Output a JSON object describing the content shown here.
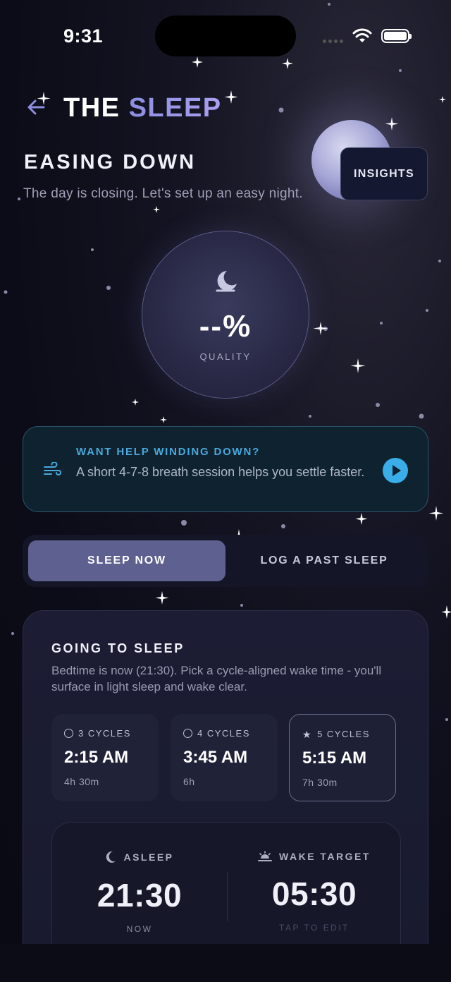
{
  "status_bar": {
    "time": "9:31"
  },
  "header": {
    "title_part1": "THE",
    "title_part2": "SLEEP",
    "insights_label": "INSIGHTS"
  },
  "intro": {
    "heading": "EASING DOWN",
    "subtitle": "The day is closing. Let's set up an easy night."
  },
  "quality": {
    "value": "--%",
    "label": "QUALITY"
  },
  "wind_down": {
    "title": "WANT HELP WINDING DOWN?",
    "description": "A short 4-7-8 breath session helps you settle faster."
  },
  "mode_toggle": {
    "active": "SLEEP NOW",
    "inactive": "LOG A PAST SLEEP"
  },
  "going_to_sleep": {
    "title": "GOING TO SLEEP",
    "description": "Bedtime is now (21:30). Pick a cycle-aligned wake time - you'll surface in light sleep and wake clear.",
    "cycles": [
      {
        "label": "3 CYCLES",
        "time": "2:15 AM",
        "duration": "4h 30m",
        "selected": false
      },
      {
        "label": "4 CYCLES",
        "time": "3:45 AM",
        "duration": "6h",
        "selected": false
      },
      {
        "label": "5 CYCLES",
        "time": "5:15 AM",
        "duration": "7h 30m",
        "selected": true
      }
    ],
    "asleep": {
      "label": "ASLEEP",
      "time": "21:30",
      "footer": "NOW"
    },
    "wake": {
      "label": "WAKE TARGET",
      "time": "05:30",
      "footer": "TAP TO EDIT"
    }
  },
  "colors": {
    "accent": "#8c8ee0",
    "wind_accent": "#4aa8dc",
    "play": "#3aaee8",
    "toggle_active": "#5e6090"
  }
}
